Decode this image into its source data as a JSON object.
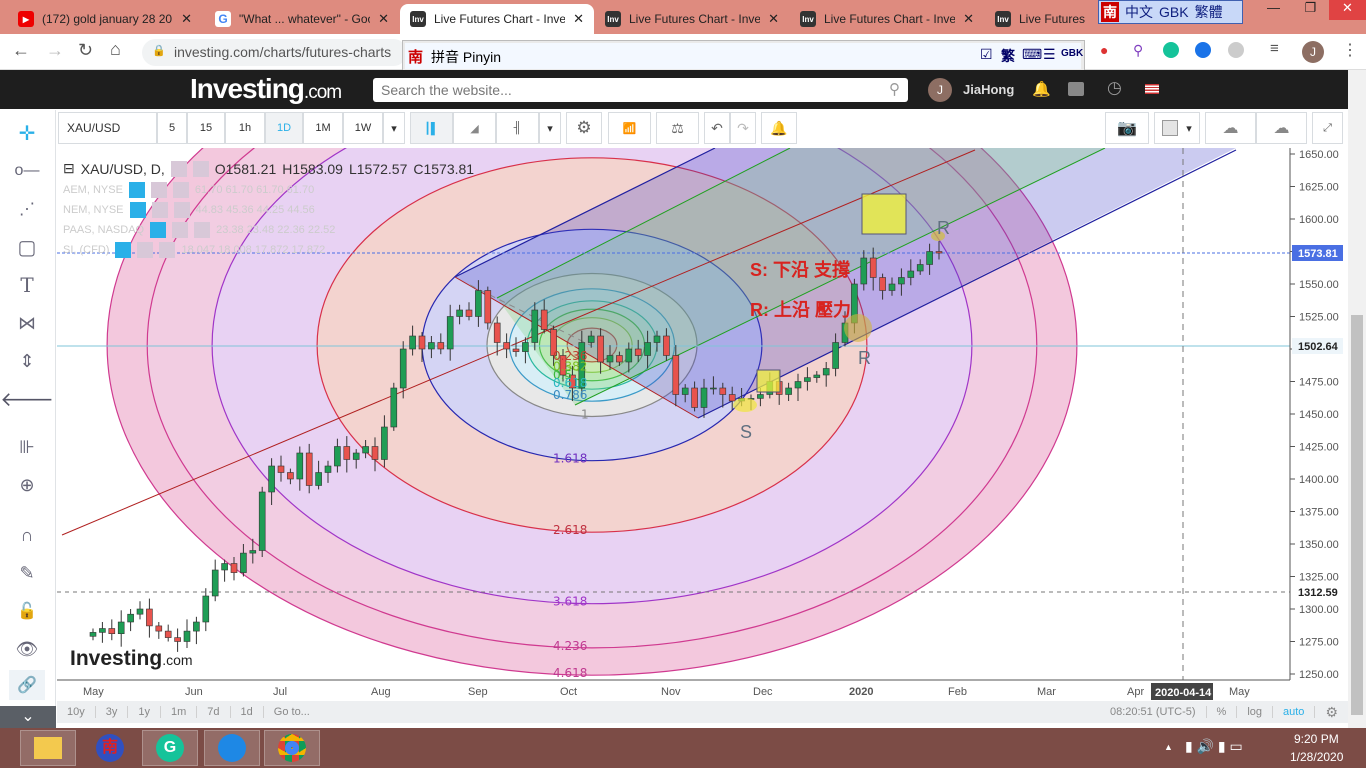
{
  "browser": {
    "tabs": [
      {
        "title": "(172) gold january 28 20",
        "icon": "youtube-icon"
      },
      {
        "title": "\"What ... whatever\" - Goo",
        "icon": "google-icon"
      },
      {
        "title": "Live Futures Chart - Inves",
        "icon": "investing-icon",
        "active": true
      },
      {
        "title": "Live Futures Chart - Inves",
        "icon": "investing-icon"
      },
      {
        "title": "Live Futures Chart - Inves",
        "icon": "investing-icon"
      },
      {
        "title": "Live Futures Ch",
        "icon": "investing-icon"
      }
    ],
    "url": "investing.com/charts/futures-charts",
    "ime_bar": {
      "logo": "南",
      "mode": "中文",
      "encoding": "GBK",
      "script": "繁體"
    },
    "pinyin_bar": {
      "logo": "南",
      "label": "拼音 Pinyin",
      "trad": "繁",
      "gbk": "GBK"
    },
    "profile_initial": "J"
  },
  "site": {
    "logo": "Investing",
    "logo_suffix": ".com",
    "search_placeholder": "Search the website...",
    "user_initial": "J",
    "user_name": "JiaHong"
  },
  "toolbar": {
    "symbol": "XAU/USD",
    "intervals": [
      "5",
      "15",
      "1h",
      "1D",
      "1M",
      "1W"
    ],
    "active_interval": "1D"
  },
  "legend": {
    "main": {
      "name": "XAU/USD, D,",
      "o": "O1581.21",
      "h": "H1583.09",
      "l": "L1572.57",
      "c": "C1573.81"
    },
    "overlays": [
      {
        "name": "AEM, NYSE",
        "values": "61.70   61.70   61.70   61.70"
      },
      {
        "name": "NEM, NYSE",
        "values": "44.83   45.36   44.25   44.56"
      },
      {
        "name": "PAAS, NASDAQ",
        "values": "23.38   23.48   22.36   22.52"
      },
      {
        "name": "SI, (CFD)",
        "values": "18.047   18.008   17.872   17.872"
      }
    ]
  },
  "annotations": {
    "support": "S: 下沿 支撐",
    "resistance": "R: 上沿 壓力",
    "r_mark": "R",
    "s_mark": "S",
    "watermark": "Investing",
    "watermark_suffix": ".com"
  },
  "fib_levels": [
    "0.236",
    "0.382",
    "0.5",
    "0.618",
    "0.786",
    "1",
    "1.618",
    "2.618",
    "3.618",
    "4.236",
    "4.618"
  ],
  "price_axis": {
    "ticks": [
      "1650.00",
      "1625.00",
      "1600.00",
      "1575.00",
      "1550.00",
      "1525.00",
      "1500.00",
      "1475.00",
      "1450.00",
      "1425.00",
      "1400.00",
      "1375.00",
      "1350.00",
      "1325.00",
      "1300.00",
      "1275.00",
      "1250.00"
    ],
    "last_price": "1573.81",
    "crosshair_price": "1502.64",
    "marker_price": "1312.59"
  },
  "time_axis": {
    "labels": [
      "May",
      "Jun",
      "Jul",
      "Aug",
      "Sep",
      "Oct",
      "Nov",
      "Dec",
      "2020",
      "Feb",
      "Mar",
      "Apr",
      "May"
    ],
    "cursor_date": "2020-04-14"
  },
  "bottom_bar": {
    "ranges": [
      "10y",
      "3y",
      "1y",
      "1m",
      "7d",
      "1d"
    ],
    "goto": "Go to...",
    "clock": "08:20:51 (UTC-5)",
    "percent": "%",
    "log": "log",
    "auto": "auto"
  },
  "taskbar": {
    "time": "9:20 PM",
    "date": "1/28/2020"
  },
  "colors": {
    "up": "#1f9d55",
    "down": "#e8534d",
    "accent": "#2ab0e8",
    "last_price": "#4a6fe3"
  },
  "chart_data": {
    "type": "candlestick",
    "symbol": "XAU/USD",
    "interval": "1D",
    "start": "2019-05-01",
    "step_days": 3,
    "ylim": [
      1250,
      1650
    ],
    "closes": [
      1282,
      1285,
      1281,
      1290,
      1296,
      1300,
      1287,
      1283,
      1278,
      1275,
      1283,
      1290,
      1310,
      1330,
      1335,
      1328,
      1343,
      1345,
      1390,
      1410,
      1405,
      1400,
      1420,
      1395,
      1405,
      1410,
      1425,
      1415,
      1420,
      1425,
      1415,
      1440,
      1470,
      1500,
      1510,
      1500,
      1505,
      1500,
      1525,
      1530,
      1525,
      1545,
      1520,
      1505,
      1500,
      1498,
      1505,
      1530,
      1515,
      1495,
      1480,
      1470,
      1505,
      1510,
      1490,
      1495,
      1490,
      1500,
      1495,
      1505,
      1510,
      1495,
      1465,
      1470,
      1455,
      1470,
      1470,
      1465,
      1460,
      1462,
      1462,
      1465,
      1475,
      1465,
      1470,
      1475,
      1478,
      1480,
      1485,
      1505,
      1520,
      1550,
      1570,
      1555,
      1545,
      1550,
      1555,
      1560,
      1565,
      1575,
      1573.81
    ]
  }
}
